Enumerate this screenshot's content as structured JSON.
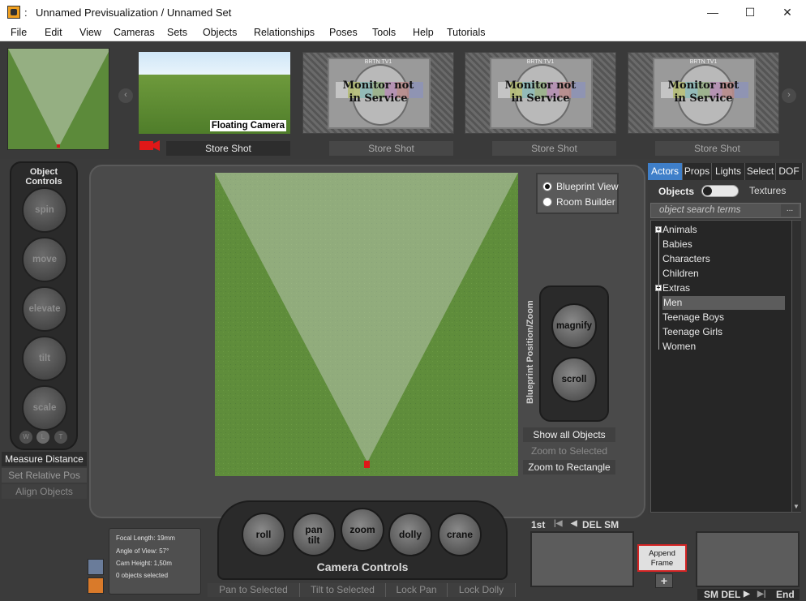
{
  "window": {
    "colon": ":",
    "title": "Unnamed Previsualization  /  Unnamed Set",
    "minimize_glyph": "—",
    "maximize_glyph": "☐",
    "close_glyph": "✕"
  },
  "menu": [
    "File",
    "Edit",
    "View",
    "Cameras",
    "Sets",
    "Objects",
    "Relationships",
    "Poses",
    "Tools",
    "Help",
    "Tutorials"
  ],
  "shots": {
    "prev_arrow": "‹",
    "next_arrow": "›",
    "first_caption": "Floating Camera",
    "monitor_label": "BRTN TV1",
    "monitor_text_1": "Monitor not",
    "monitor_text_2": "in Service",
    "store_shot_label": "Store Shot"
  },
  "object_controls": {
    "title_1": "Object",
    "title_2": "Controls",
    "knobs": [
      "spin",
      "move",
      "elevate",
      "tilt",
      "scale"
    ],
    "mini": [
      "W",
      "L",
      "T"
    ],
    "measure_distance": "Measure Distance",
    "set_relative_pos": "Set Relative Pos",
    "align_objects": "Align Objects"
  },
  "viewport": {
    "blueprint_view": "Blueprint View",
    "room_builder": "Room Builder",
    "blueprint_panel_label": "Blueprint Position/Zoom",
    "magnify": "magnify",
    "scroll": "scroll",
    "show_all_objects": "Show all Objects",
    "zoom_to_selected": "Zoom to Selected",
    "zoom_to_rectangle": "Zoom to Rectangle"
  },
  "right_panel": {
    "tabs": [
      "Actors",
      "Props",
      "Lights",
      "Select",
      "DOF"
    ],
    "objects_label": "Objects",
    "textures_label": "Textures",
    "search_placeholder": "object search terms",
    "search_more": "...",
    "tree": [
      "Animals",
      "Babies",
      "Characters",
      "Children",
      "Extras",
      "Men",
      "Teenage Boys",
      "Teenage Girls",
      "Women"
    ],
    "selected_item": "Men",
    "expandable": [
      "Animals",
      "Extras"
    ],
    "scroll_down": "▼"
  },
  "info": {
    "focal_length": "Focal Length: 19mm",
    "angle_of_view": "Angle of View: 57°",
    "cam_height": "Cam Height: 1,50m",
    "objects_selected": "0 objects selected"
  },
  "camera_controls": {
    "knobs": [
      "roll",
      "pan\ntilt",
      "zoom",
      "dolly",
      "crane"
    ],
    "label": "Camera Controls",
    "pan_to_selected": "Pan to Selected",
    "tilt_to_selected": "Tilt to Selected",
    "lock_pan": "Lock Pan",
    "lock_dolly": "Lock Dolly"
  },
  "frames": {
    "first": "1st",
    "first_arrow": "|◀",
    "prev_arrow": "◀",
    "del_sm": "DEL SM",
    "append_frame_1": "Append",
    "append_frame_2": "Frame",
    "plus": "+",
    "sm_del": "SM DEL",
    "next_arrow": "▶",
    "last_arrow": "▶|",
    "end": "End"
  },
  "colors": {
    "accent_tab": "#3f7fc9",
    "append_border": "#d42424",
    "grass": "#5f8d3b"
  }
}
